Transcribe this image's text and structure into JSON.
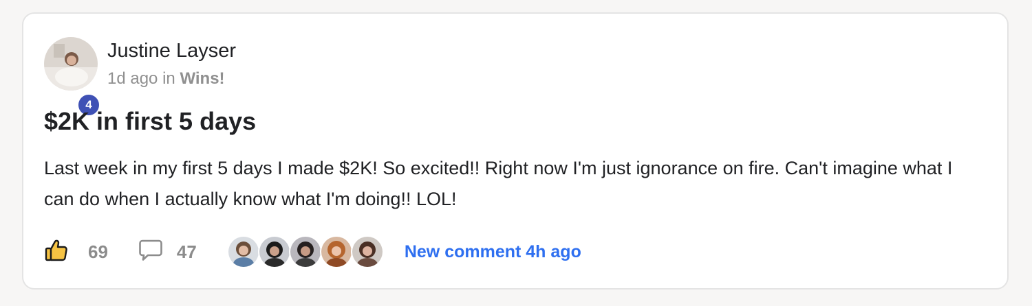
{
  "post": {
    "author": {
      "name": "Justine Layser",
      "level": "4"
    },
    "time_ago": "1d ago",
    "in_word": "in",
    "category": "Wins!",
    "title": "$2K in first 5 days",
    "body": "Last week in my first 5 days I made $2K! So excited!! Right now I'm just ignorance on fire. Can't imagine what I can do when I actually know what I'm doing!! LOL!",
    "likes": "69",
    "comments": "47",
    "new_comment_text": "New comment 4h ago"
  },
  "icons": {
    "like": "thumbs-up-icon",
    "comment": "speech-bubble-icon"
  },
  "colors": {
    "level_badge": "#3f51b5",
    "link": "#2e6ff0",
    "like_fill": "#f6c343",
    "card_border": "#e4e4e4"
  }
}
